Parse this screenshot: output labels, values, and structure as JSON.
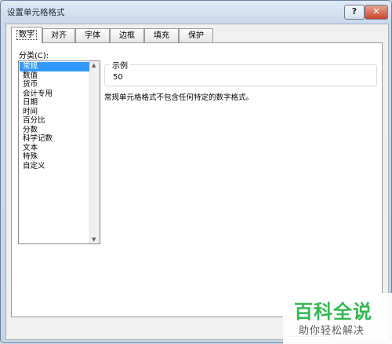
{
  "window": {
    "title": "设置单元格格式",
    "help_label": "?",
    "close_label": "✕"
  },
  "tabs": [
    {
      "label": "数字",
      "active": true
    },
    {
      "label": "对齐",
      "active": false
    },
    {
      "label": "字体",
      "active": false
    },
    {
      "label": "边框",
      "active": false
    },
    {
      "label": "填充",
      "active": false
    },
    {
      "label": "保护",
      "active": false
    }
  ],
  "category": {
    "label": "分类(C):",
    "items": [
      "常规",
      "数值",
      "货币",
      "会计专用",
      "日期",
      "时间",
      "百分比",
      "分数",
      "科学记数",
      "文本",
      "特殊",
      "自定义"
    ],
    "selected": "常规"
  },
  "sample": {
    "legend": "示例",
    "value": "50"
  },
  "description": "常规单元格格式不包含任何特定的数字格式。",
  "watermark": {
    "main": "百科全说",
    "sub": "助你轻松解决"
  }
}
